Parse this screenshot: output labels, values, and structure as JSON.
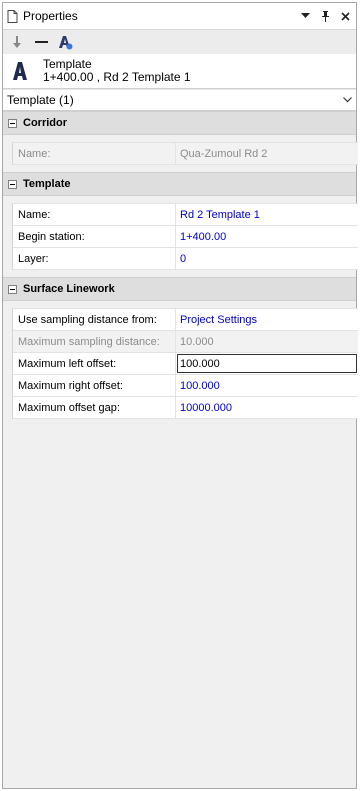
{
  "window": {
    "title": "Properties"
  },
  "selection": {
    "type": "Template",
    "description": "1+400.00 , Rd 2 Template 1"
  },
  "filter": {
    "selected": "Template (1)"
  },
  "sections": [
    {
      "title": "Corridor",
      "rows": [
        {
          "label": "Name:",
          "value": "Qua-Zumoul Rd 2",
          "state": "disabled"
        }
      ]
    },
    {
      "title": "Template",
      "rows": [
        {
          "label": "Name:",
          "value": "Rd 2 Template 1",
          "state": "normal"
        },
        {
          "label": "Begin station:",
          "value": "1+400.00",
          "state": "normal"
        },
        {
          "label": "Layer:",
          "value": "0",
          "state": "normal"
        }
      ]
    },
    {
      "title": "Surface Linework",
      "rows": [
        {
          "label": "Use sampling distance from:",
          "value": "Project Settings",
          "state": "normal"
        },
        {
          "label": "Maximum sampling distance:",
          "value": "10.000",
          "state": "disabled"
        },
        {
          "label": "Maximum left offset:",
          "value": "100.000",
          "state": "editing"
        },
        {
          "label": "Maximum right offset:",
          "value": "100.000",
          "state": "normal"
        },
        {
          "label": "Maximum offset gap:",
          "value": "10000.000",
          "state": "normal"
        }
      ]
    }
  ]
}
